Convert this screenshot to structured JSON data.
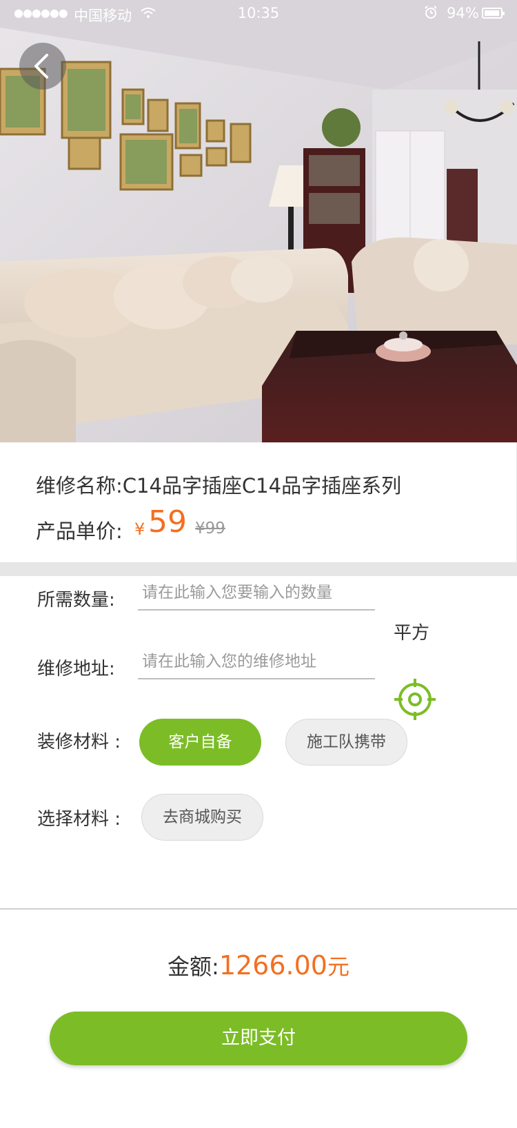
{
  "status_bar": {
    "signal_dots": "●●●●●●",
    "carrier": "中国移动",
    "time": "10:35",
    "battery_percent": "94%",
    "battery_level": 0.94
  },
  "hero": {
    "back_icon": "chevron-left-icon"
  },
  "product": {
    "name_label": "维修名称:",
    "name_value": "C14品字插座C14品字插座系列",
    "price_label": "产品单价:",
    "price_currency": "¥",
    "price_value": "59",
    "price_original": "¥99"
  },
  "form": {
    "quantity": {
      "label": "所需数量:",
      "placeholder": "请在此输入您要输入的数量",
      "unit": "平方"
    },
    "address": {
      "label": "维修地址:",
      "placeholder": "请在此输入您的维修地址",
      "locate_icon": "crosshair-location-icon"
    },
    "material": {
      "label": "装修材料 :",
      "options": [
        "客户自备",
        "施工队携带"
      ],
      "selected": "客户自备"
    },
    "choose_material": {
      "label": "选择材料 :",
      "button": "去商城购买"
    }
  },
  "total": {
    "label": "金额:",
    "amount": "1266.00",
    "unit": "元"
  },
  "pay_button": "立即支付",
  "colors": {
    "accent_green": "#7cbd27",
    "price_orange": "#f36f20",
    "divider_gray": "#e6e6e6"
  }
}
